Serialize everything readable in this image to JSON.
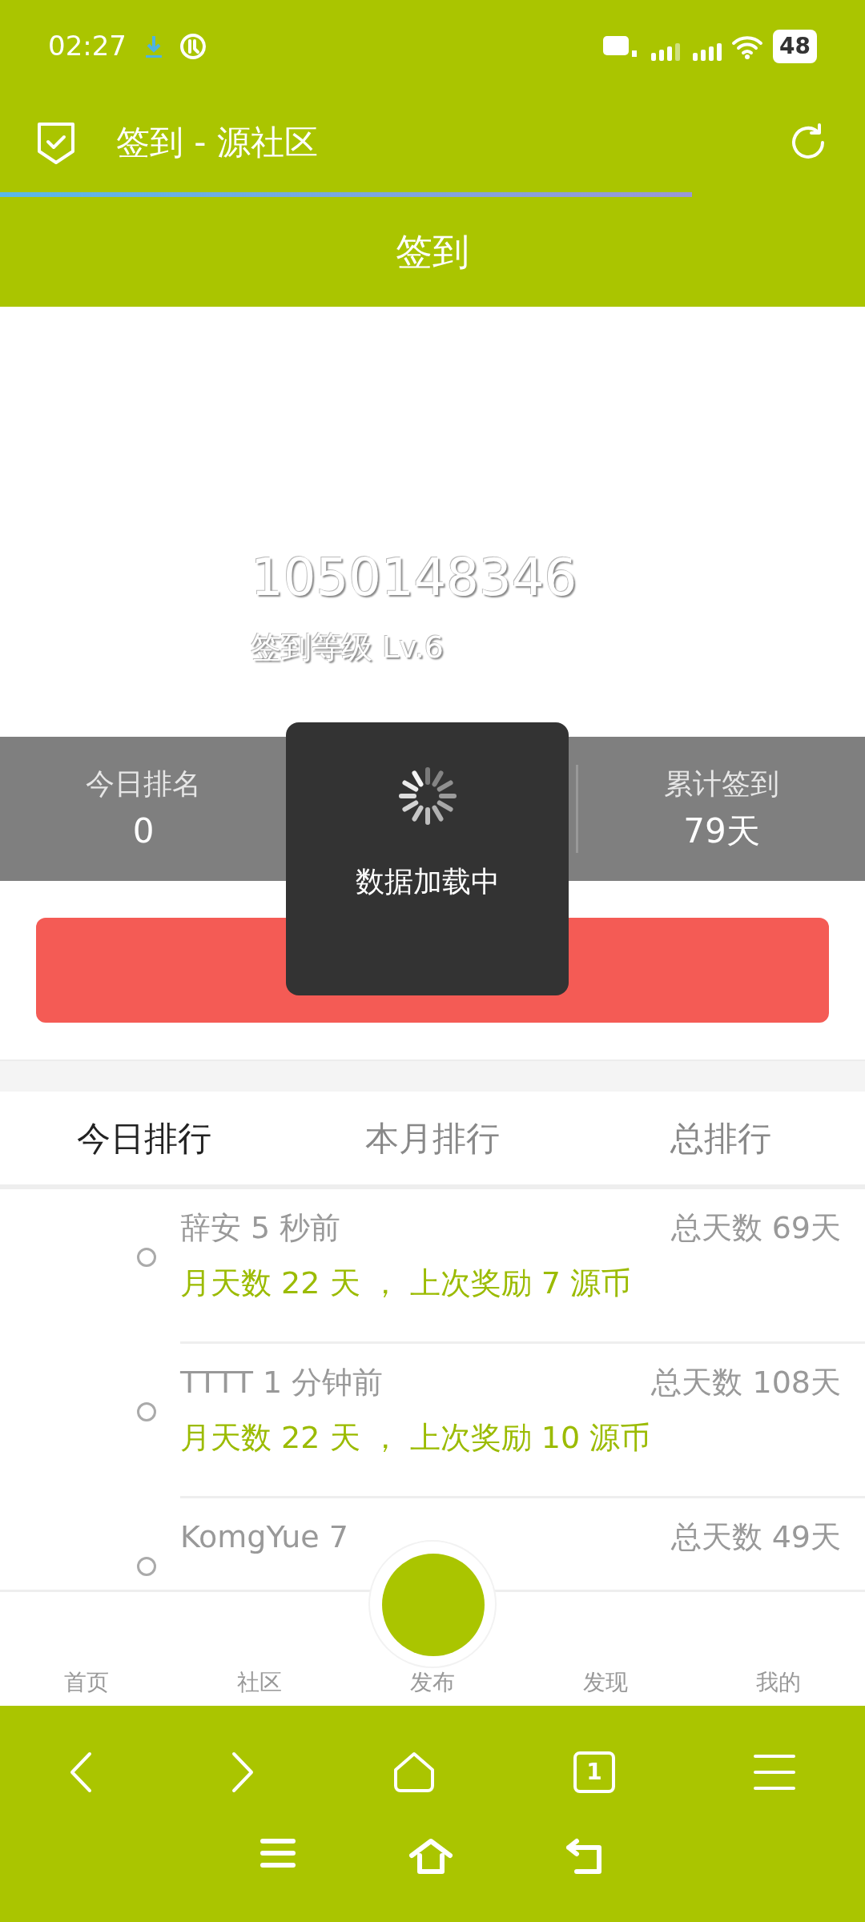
{
  "status_bar": {
    "time": "02:27",
    "battery": "48"
  },
  "app_bar": {
    "title": "签到 - 源社区",
    "progress": {
      "level": 0.8
    }
  },
  "header": {
    "title": "签到"
  },
  "profile": {
    "user_id": "1050148346",
    "sign_level": "签到等级 Lv.6"
  },
  "stats": [
    {
      "label": "今日排名",
      "value": "0"
    },
    {
      "label": "累计签到",
      "value": "79天"
    }
  ],
  "loading": {
    "text": "数据加载中"
  },
  "tabs": [
    {
      "label": "今日排行",
      "selected": true
    },
    {
      "label": "本月排行",
      "selected": false
    },
    {
      "label": "总排行",
      "selected": false
    }
  ],
  "records": [
    {
      "name_time": "辞安 5 秒前",
      "total": "总天数 69天",
      "detail": "月天数 22 天 ， 上次奖励 7 源币"
    },
    {
      "name_time": "TTTT 1 分钟前",
      "total": "总天数 108天",
      "detail": "月天数 22 天 ， 上次奖励 10 源币"
    },
    {
      "name_time": "KomgYue 7",
      "total": "总天数 49天"
    }
  ],
  "bottom_nav": [
    {
      "label": "首页"
    },
    {
      "label": "社区"
    },
    {
      "label": "发布",
      "kind": "fab"
    },
    {
      "label": "发现"
    },
    {
      "label": "我的"
    }
  ],
  "browser_bar": {
    "tab_count": "1"
  }
}
